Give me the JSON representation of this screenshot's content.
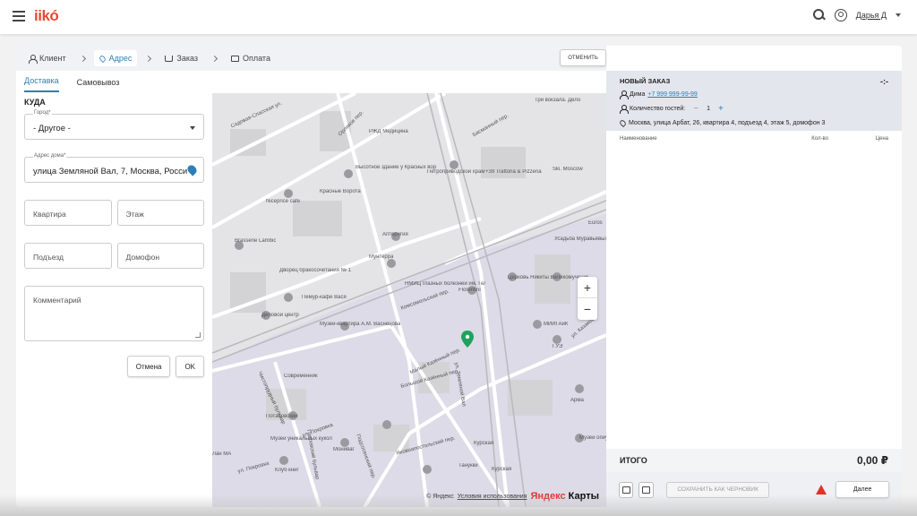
{
  "header": {
    "logo": "iikó",
    "user_name": "Дарья Д"
  },
  "steps": [
    {
      "label": "Клиент"
    },
    {
      "label": "Адрес"
    },
    {
      "label": "Заказ"
    },
    {
      "label": "Оплата"
    }
  ],
  "cancel_top_label": "ОТМЕНИТЬ",
  "tabs": [
    {
      "label": "Доставка"
    },
    {
      "label": "Самовывоз"
    }
  ],
  "form": {
    "section_title": "КУДА",
    "city_label": "Город*",
    "city_value": "- Другое -",
    "address_label": "Адрес дома*",
    "address_value": "улица Земляной Вал, 7, Москва, Россия",
    "apartment_placeholder": "Квартира",
    "floor_placeholder": "Этаж",
    "entrance_placeholder": "Подъезд",
    "intercom_placeholder": "Домофон",
    "comment_placeholder": "Комментарий",
    "cancel_label": "Отмена",
    "ok_label": "OK"
  },
  "map": {
    "labels": [
      "Садовая-Спасская ул.",
      "Орликов пер.",
      "РЖД Медицина",
      "Высотное здание у Красных ворот",
      "Красные Ворота",
      "Niceprice cafe",
      "Петроприводской храм",
      "+39 Trattoria & Pizzeria",
      "Ski. Moscow",
      "Три вокзала. Дело",
      "Басманный пер.",
      "Аптеригия",
      "Мунтерра",
      "Brasserie Lambic",
      "Дворец бракосочетания № 1",
      "Пемур-кафе Вася",
      "НМИЦ глазных болезней им. Гельмгольца",
      "Florentini",
      "Церковь Никиты Великомученика",
      "Усадьба Муравьёвых-Апостолов",
      "Euros",
      "Деловой центр",
      "Музей-квартира А.М. Васнецова",
      "МИИГАиК",
      "ГУЭ",
      "ул. Казакова",
      "Современник",
      "Арма",
      "Потаповский",
      "ул. Покровка",
      "Музей уникальных кукол",
      "Мониваг",
      "Клуб книг",
      "Курская",
      "Курская",
      "Танукки",
      "Музей опиума",
      "Лан МА",
      "ул. Земляной Вал",
      "Комсомольский пер.",
      "Большой Казённый пер.",
      "Малый Казённый пер.",
      "ул. Покровка",
      "Подсосенский пер.",
      "Яковоапостольский пер.",
      "Чистопрудный бульвар",
      "Покровский бульвар"
    ],
    "zoom_in": "+",
    "zoom_out": "−",
    "copyright": "© Яндекс",
    "terms_link": "Условия использования",
    "brand_part1": "Яндекс",
    "brand_part2": " Карты",
    "marker_color": "#1fa35b"
  },
  "order": {
    "title": "НОВЫЙ ЗАКАЗ",
    "status": "-:-",
    "client_name": "Дима",
    "client_phone": "+7 999 999-99-99",
    "guests_label": "Количество гостей:",
    "guests_minus": "−",
    "guests_count": "1",
    "guests_plus": "+",
    "address": "Москва, улица Арбат, 26, квартира 4, подъезд 4, этаж 5, домофон 3",
    "col_name": "Наименование",
    "col_qty": "Кол-во",
    "col_price": "Цена",
    "total_label": "ИТОГО",
    "total_value": "0,00 ₽",
    "save_draft_label": "СОХРАНИТЬ КАК ЧЕРНОВИК",
    "next_label": "Далее"
  },
  "colors": {
    "accent": "#2c7fb8",
    "brand": "#e8492f",
    "warning": "#e0322d"
  }
}
